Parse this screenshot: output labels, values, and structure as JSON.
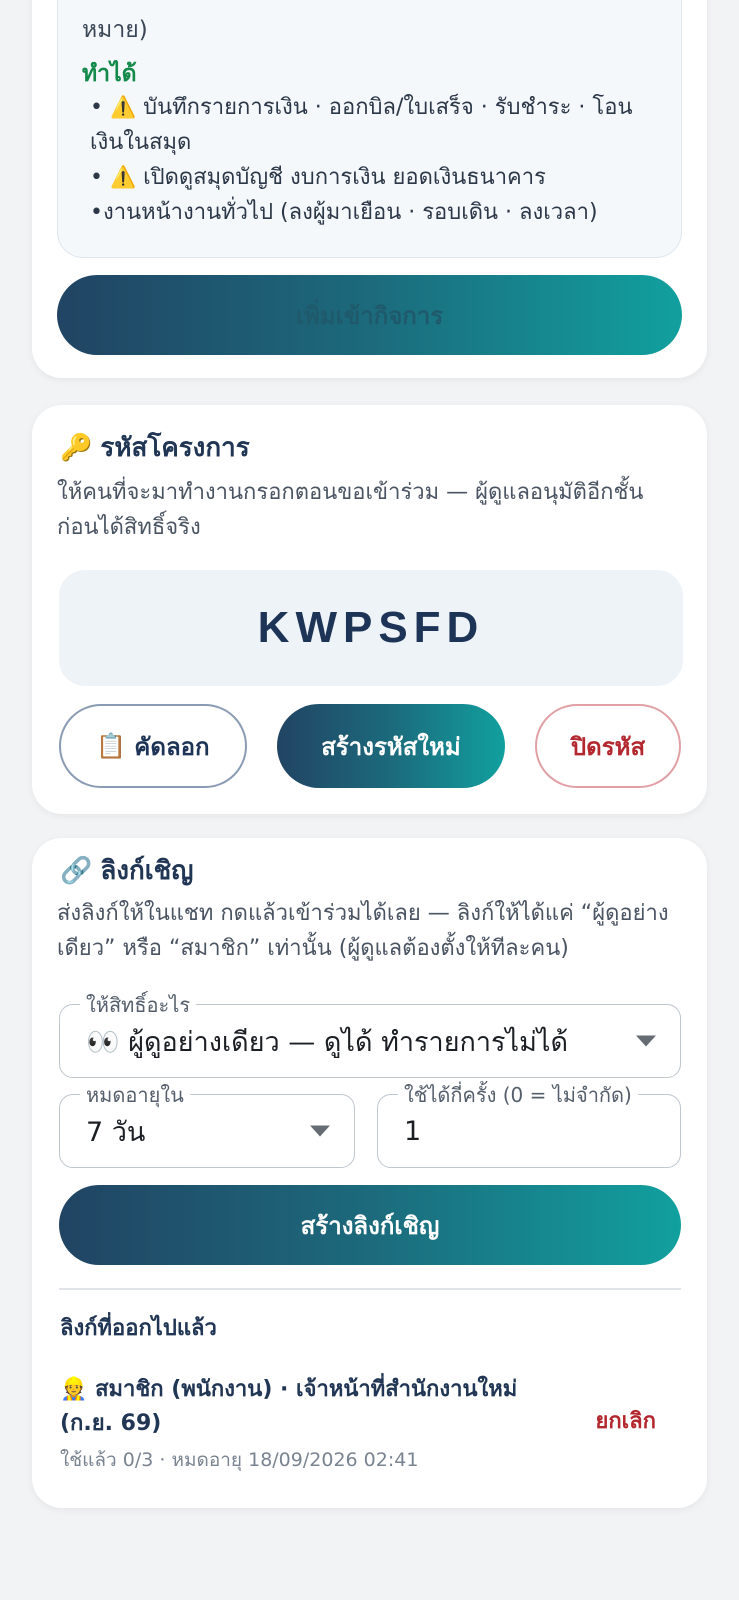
{
  "role_card": {
    "cut_text": "หมาย)",
    "can_title": "ทำได้",
    "can_items": [
      {
        "warn": "⚠️",
        "text": "บันทึกรายการเงิน · ออกบิล/ใบเสร็จ · รับชำระ · โอนเงินในสมุด"
      },
      {
        "warn": "⚠️",
        "text": "เปิดดูสมุดบัญชี งบการเงิน ยอดเงินธนาคาร"
      },
      {
        "warn": "",
        "text": "งานหน้างานทั่วไป (ลงผู้มาเยือน · รอบเดิน · ลงเวลา)"
      }
    ],
    "add_button": "เพิ่มเข้ากิจการ"
  },
  "code_card": {
    "icon": "🔑",
    "title": "รหัสโครงการ",
    "description": "ให้คนที่จะมาทำงานกรอกตอนขอเข้าร่วม — ผู้ดูแลอนุมัติอีกชั้นก่อนได้สิทธิ์จริง",
    "code": "KWPSFD",
    "copy_icon": "📋",
    "copy_label": "คัดลอก",
    "regen_label": "สร้างรหัสใหม่",
    "close_label": "ปิดรหัส"
  },
  "invite_card": {
    "icon": "🔗",
    "title": "ลิงก์เชิญ",
    "description": "ส่งลิงก์ให้ในแชท กดแล้วเข้าร่วมได้เลย — ลิงก์ให้ได้แค่ “ผู้ดูอย่างเดียว” หรือ “สมาชิก” เท่านั้น (ผู้ดูแลต้องตั้งให้ทีละคน)",
    "role_field": {
      "label": "ให้สิทธิ์อะไร",
      "value": "👀 ผู้ดูอย่างเดียว — ดูได้ ทำรายการไม่ได้"
    },
    "expire_field": {
      "label": "หมดอายุใน",
      "value": "7 วัน"
    },
    "uses_field": {
      "label": "ใช้ได้กี่ครั้ง (0 = ไม่จำกัด)",
      "value": "1"
    },
    "create_button": "สร้างลิงก์เชิญ",
    "issued_title": "ลิงก์ที่ออกไปแล้ว",
    "issued": [
      {
        "icon": "👷",
        "title": "สมาชิก (พนักงาน) · เจ้าหน้าที่สำนักงานใหม่ (ก.ย. 69)",
        "meta": "ใช้แล้ว 0/3 · หมดอายุ 18/09/2026 02:41",
        "cancel_label": "ยกเลิก"
      }
    ]
  }
}
